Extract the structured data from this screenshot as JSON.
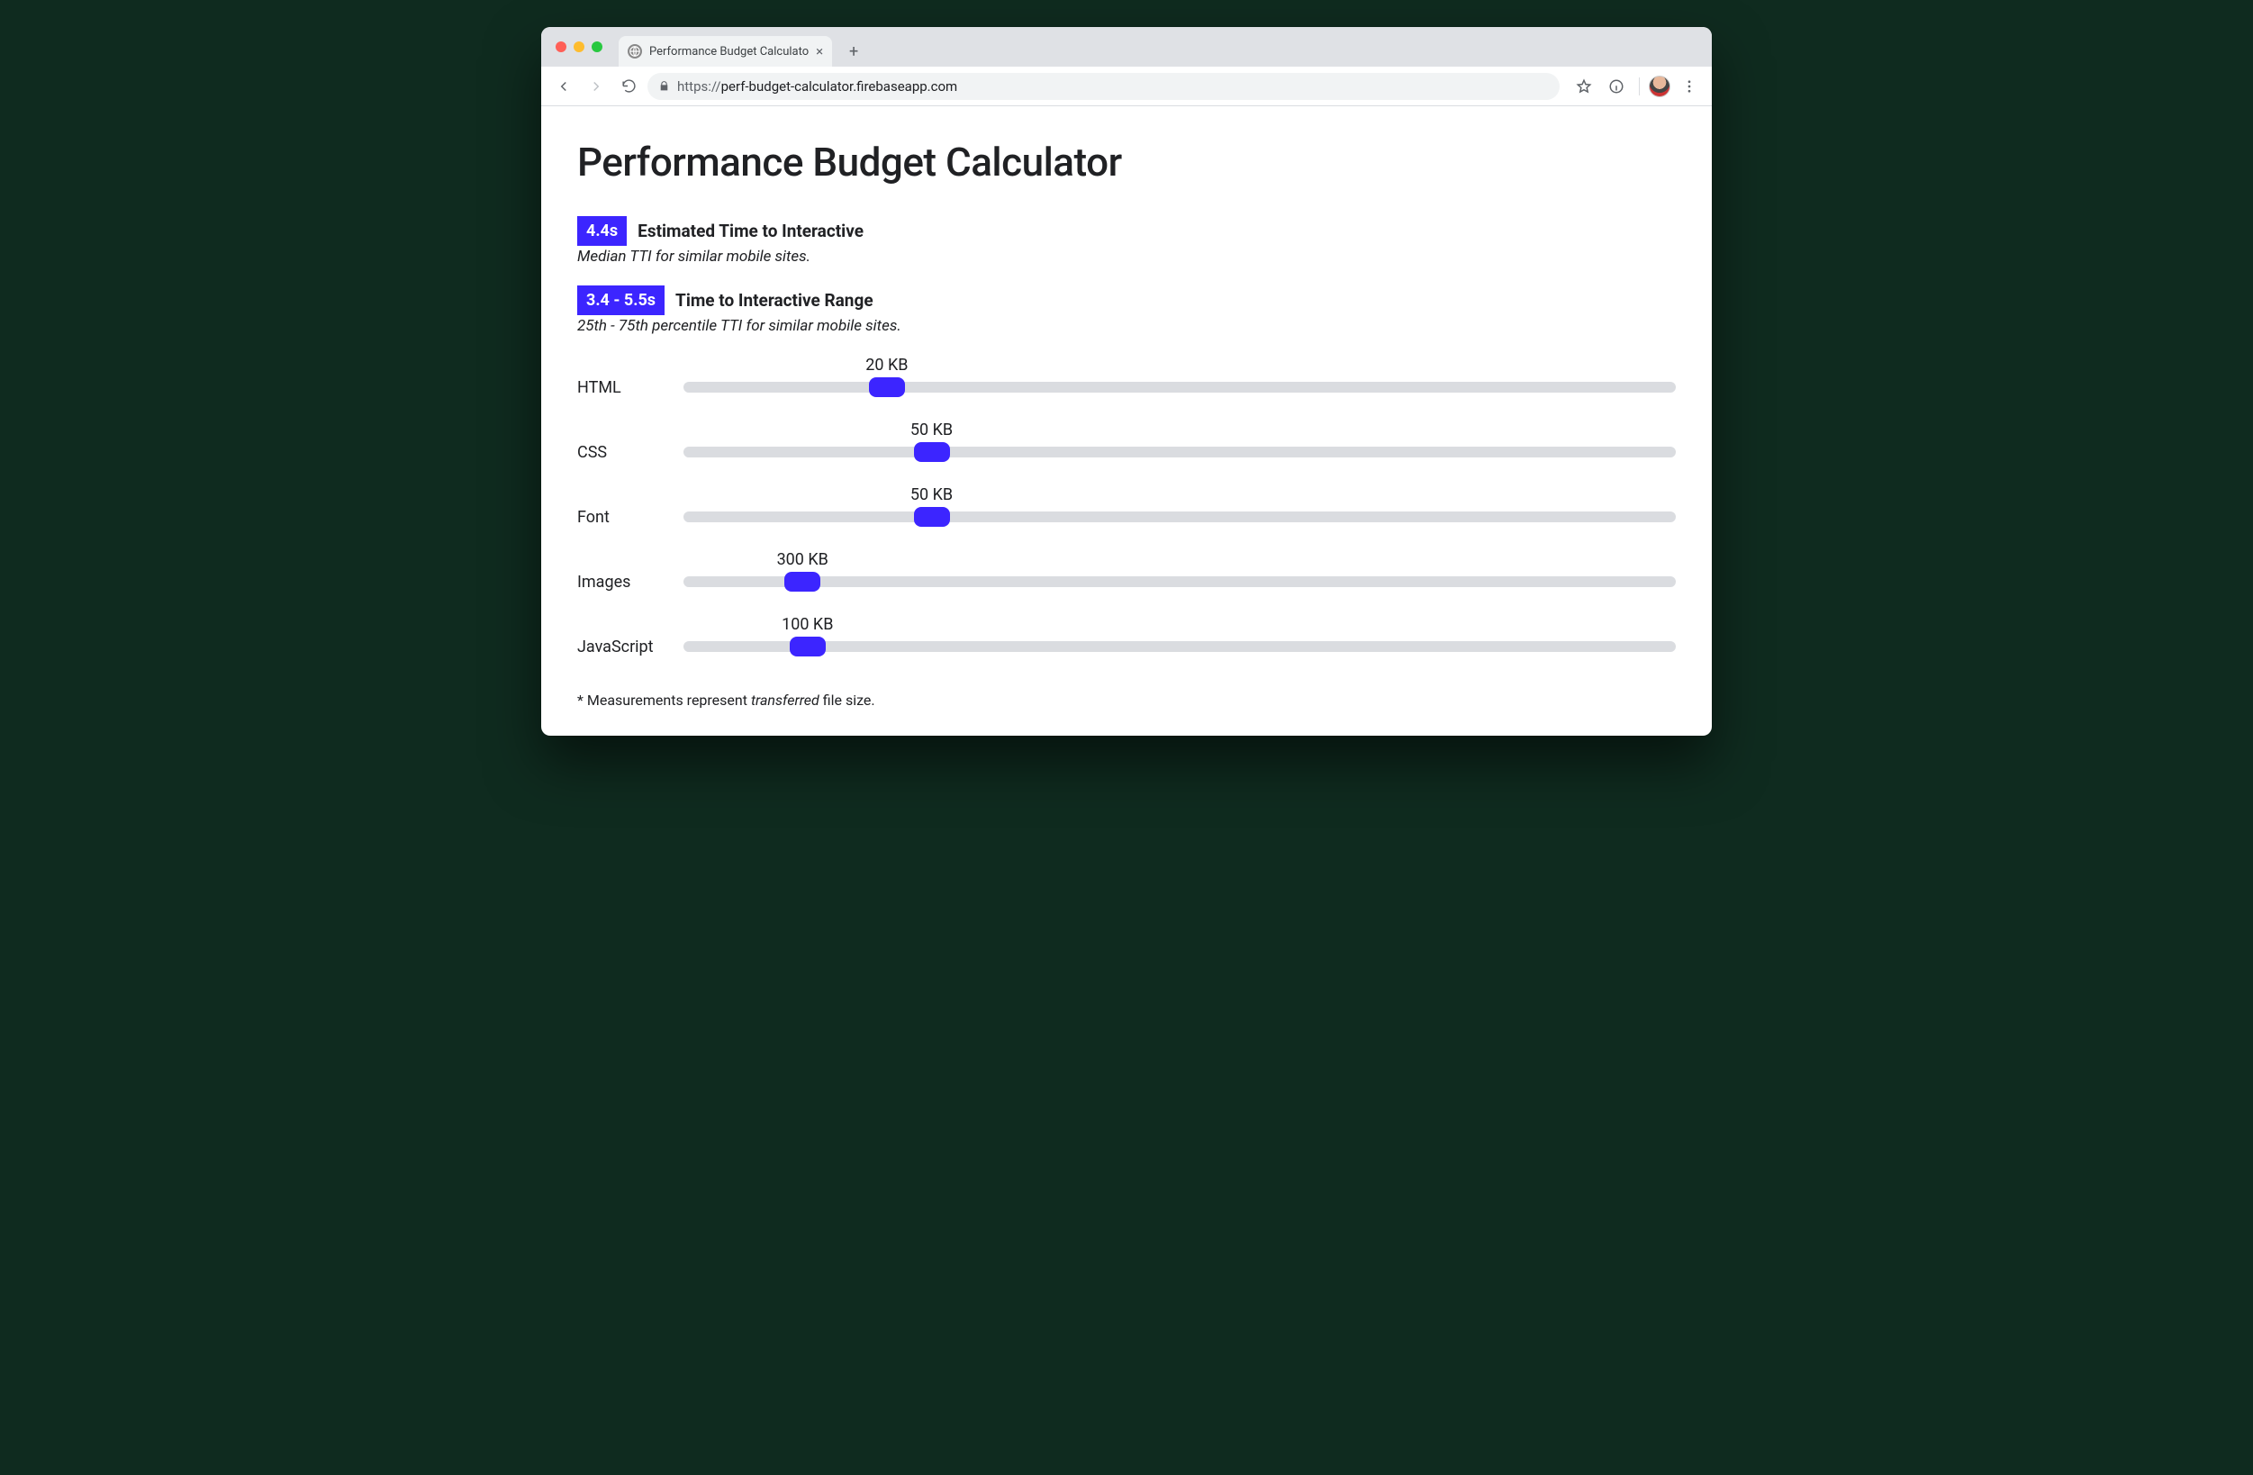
{
  "browser": {
    "tab_title": "Performance Budget Calculato",
    "url_prefix": "https://",
    "url_host": "perf-budget-calculator.firebaseapp.com"
  },
  "page": {
    "title": "Performance Budget Calculator",
    "metric1": {
      "badge": "4.4s",
      "label": "Estimated Time to Interactive",
      "sub": "Median TTI for similar mobile sites."
    },
    "metric2": {
      "badge": "3.4 - 5.5s",
      "label": "Time to Interactive Range",
      "sub": "25th - 75th percentile TTI for similar mobile sites."
    },
    "sliders": [
      {
        "label": "HTML",
        "value_text": "20 KB",
        "pos_pct": 20.5
      },
      {
        "label": "CSS",
        "value_text": "50 KB",
        "pos_pct": 25.0
      },
      {
        "label": "Font",
        "value_text": "50 KB",
        "pos_pct": 25.0
      },
      {
        "label": "Images",
        "value_text": "300 KB",
        "pos_pct": 12.0
      },
      {
        "label": "JavaScript",
        "value_text": "100 KB",
        "pos_pct": 12.5
      }
    ],
    "footnote_pre": "* Measurements represent ",
    "footnote_ital": "transferred",
    "footnote_post": " file size."
  }
}
